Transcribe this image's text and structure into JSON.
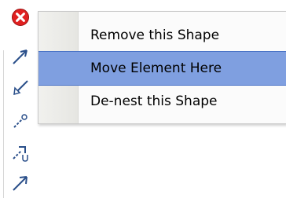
{
  "toolbar": {
    "tools": [
      {
        "icon": "close-icon"
      },
      {
        "icon": "arrow-connector-icon"
      },
      {
        "icon": "reverse-arrow-connector-icon"
      },
      {
        "icon": "key-connector-icon"
      },
      {
        "icon": "nested-connector-icon"
      },
      {
        "icon": "diagonal-arrow-icon"
      }
    ]
  },
  "menu": {
    "items": [
      {
        "label": "Remove this Shape",
        "highlighted": false
      },
      {
        "label": "Move Element Here",
        "highlighted": true
      },
      {
        "label": "De-nest this Shape",
        "highlighted": false
      }
    ]
  },
  "colors": {
    "highlight": "#7f9fe0",
    "close_red": "#e02020",
    "icon_blue": "#2a4f8a"
  }
}
